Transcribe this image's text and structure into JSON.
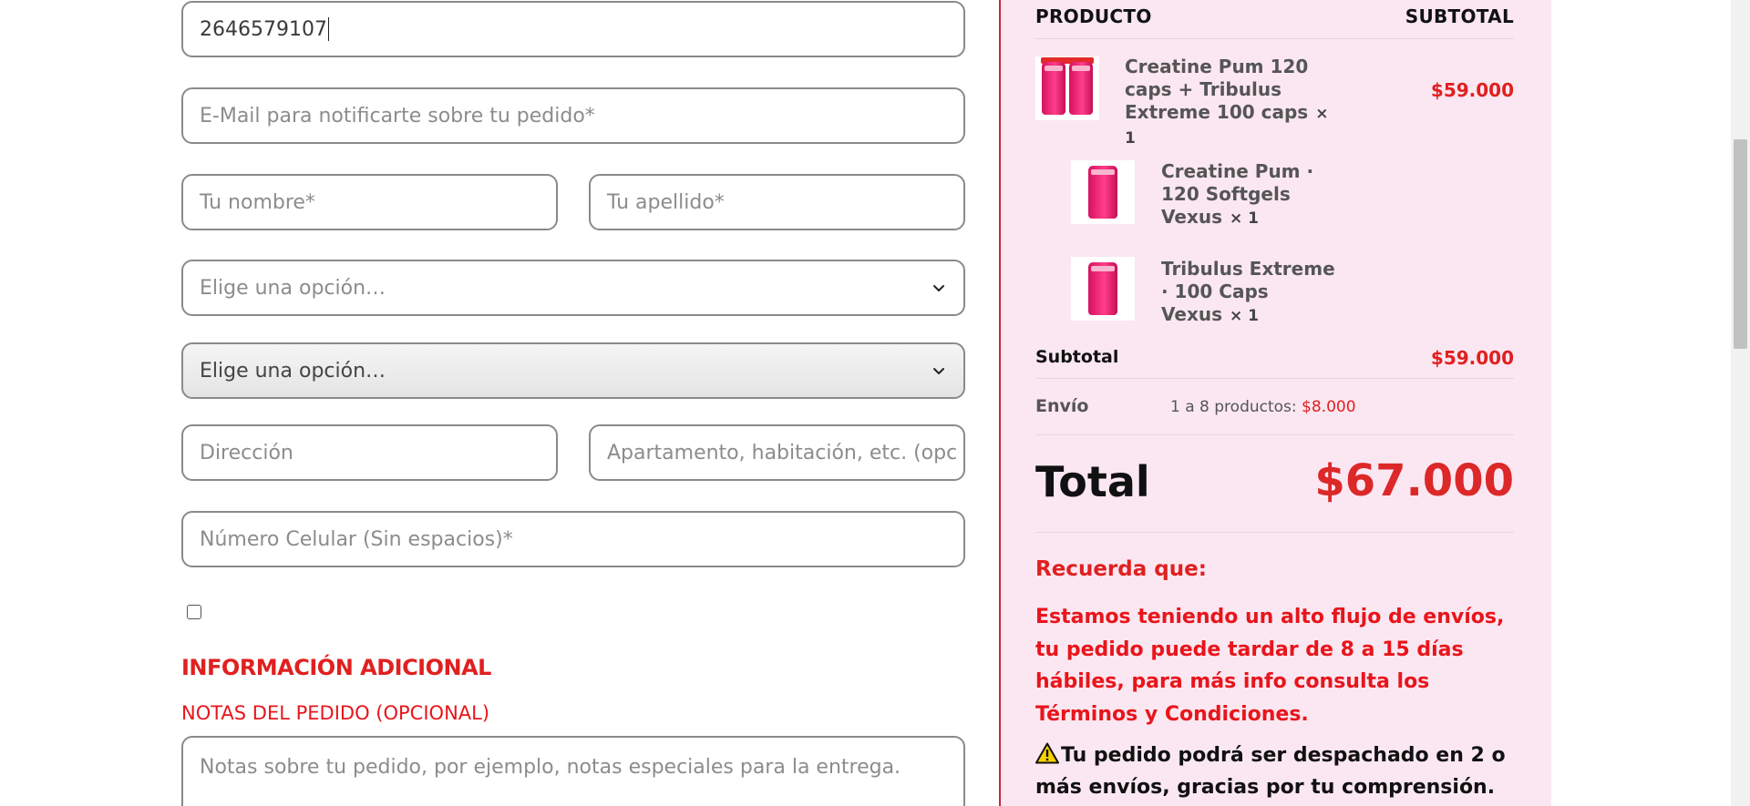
{
  "form": {
    "phone_value": "2646579107",
    "email_placeholder": "E-Mail para notificarte sobre tu pedido*",
    "first_name_placeholder": "Tu nombre*",
    "last_name_placeholder": "Tu apellido*",
    "select1_value": "Elige una opción…",
    "select2_value": "Elige una opción…",
    "address_placeholder": "Dirección",
    "apartment_placeholder": "Apartamento, habitación, etc. (opc",
    "mobile_placeholder": "Número Celular (Sin espacios)*",
    "additional_heading": "INFORMACIÓN ADICIONAL",
    "notes_label": "NOTAS DEL PEDIDO (OPCIONAL)",
    "notes_placeholder": "Notas sobre tu pedido, por ejemplo, notas especiales para la entrega.",
    "checkbox_checked": false
  },
  "summary": {
    "col_product": "PRODUCTO",
    "col_subtotal": "SUBTOTAL",
    "items": [
      {
        "name": "Creatine Pum 120 caps + Tribulus Extreme 100 caps",
        "qty": "× 1",
        "price": "$59.000",
        "image": "bundle-product-image"
      },
      {
        "name": "Creatine Pum · 120 Softgels Vexus",
        "qty": "× 1",
        "image": "creatine-product-image"
      },
      {
        "name": "Tribulus Extreme · 100 Caps Vexus",
        "qty": "× 1",
        "image": "tribulus-product-image"
      }
    ],
    "subtotal_label": "Subtotal",
    "subtotal_value": "$59.000",
    "shipping_label": "Envío",
    "shipping_desc": "1 a 8 productos:",
    "shipping_cost": "$8.000",
    "total_label": "Total",
    "total_value": "$67.000",
    "remember_title": "Recuerda que:",
    "remember_text": "Estamos teniendo un alto flujo de envíos, tu pedido puede tardar de 8 a 15 días hábiles, para más info consulta los Términos y Condiciones.",
    "dispatch_text": "Tu pedido podrá ser despachado en 2 o más envíos, gracias por tu comprensión.",
    "warning_icon": "warning-icon"
  },
  "colors": {
    "accent_red": "#e02020",
    "summary_bg": "#fbe7f1",
    "field_border": "#8a8a8a"
  }
}
